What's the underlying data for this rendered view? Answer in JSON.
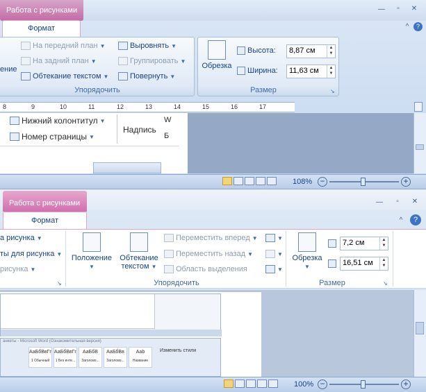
{
  "window1": {
    "context_tab": "Работа с рисунками",
    "format_tab": "Формат",
    "arrange": {
      "label": "Упорядочить",
      "partial_left": "ение",
      "bring_front": "На передний план",
      "send_back": "На задний план",
      "text_wrap": "Обтекание текстом",
      "align": "Выровнять",
      "group": "Группировать",
      "rotate": "Повернуть"
    },
    "size": {
      "label": "Размер",
      "crop": "Обрезка",
      "height_label": "Высота:",
      "height_value": "8,87 см",
      "width_label": "Ширина:",
      "width_value": "11,63 см"
    },
    "ruler_ticks": [
      "8",
      "9",
      "10",
      "11",
      "12",
      "13",
      "14",
      "15",
      "16",
      "17"
    ],
    "doc": {
      "footer": "Нижний колонтитул",
      "page_number": "Номер страницы",
      "caption": "Надпись",
      "cut_w": "W",
      "cut_b": "Б"
    },
    "zoom": "108%"
  },
  "window2": {
    "context_tab": "Работа с рисунками",
    "format_tab": "Формат",
    "left_items": [
      "а рисунка",
      "ты для рисунка",
      "рисунка"
    ],
    "arrange": {
      "label": "Упорядочить",
      "position": "Положение",
      "wrap_line1": "Обтекание",
      "wrap_line2": "текстом",
      "bring_forward": "Переместить вперед",
      "send_backward": "Переместить назад",
      "selection_pane": "Область выделения"
    },
    "size": {
      "label": "Размер",
      "crop": "Обрезка",
      "height_value": "7,2 см",
      "width_value": "16,51 см"
    },
    "thumb": {
      "title": "анкеты - Microsoft Word (Ознакомительная версия)",
      "styles": [
        "АаБбВвГг",
        "АаБбВвГг",
        "АаБбВ",
        "АаБбВв",
        "Aab"
      ],
      "style_names": [
        "1 Обычный",
        "1 Без инте...",
        "Заголово...",
        "Заголово...",
        "Название"
      ],
      "change": "Изменить стили"
    },
    "zoom": "100%"
  }
}
